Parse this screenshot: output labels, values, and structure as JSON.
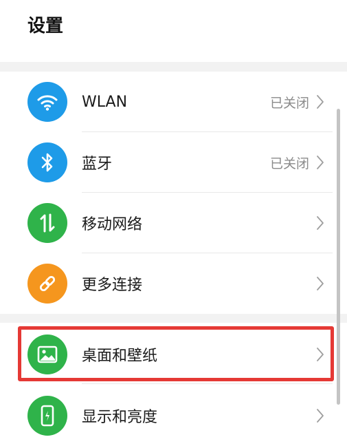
{
  "page": {
    "title": "设置"
  },
  "settings": {
    "items": [
      {
        "id": "wlan",
        "label": "WLAN",
        "status": "已关闭",
        "icon": "wifi-icon",
        "icon_color": "#1e9be8"
      },
      {
        "id": "bluetooth",
        "label": "蓝牙",
        "status": "已关闭",
        "icon": "bluetooth-icon",
        "icon_color": "#1e9be8"
      },
      {
        "id": "mobile-network",
        "label": "移动网络",
        "status": "",
        "icon": "mobile-data-icon",
        "icon_color": "#2fb34a"
      },
      {
        "id": "more-connections",
        "label": "更多连接",
        "status": "",
        "icon": "link-icon",
        "icon_color": "#f5961e"
      },
      {
        "id": "desktop-wallpaper",
        "label": "桌面和壁纸",
        "status": "",
        "icon": "picture-icon",
        "icon_color": "#2fb34a",
        "highlighted": true
      },
      {
        "id": "display-brightness",
        "label": "显示和亮度",
        "status": "",
        "icon": "phone-display-icon",
        "icon_color": "#2fb34a"
      }
    ]
  },
  "colors": {
    "highlight_border": "#e53935",
    "chevron": "#9e9e9e",
    "status_text": "#8a8a8a"
  }
}
